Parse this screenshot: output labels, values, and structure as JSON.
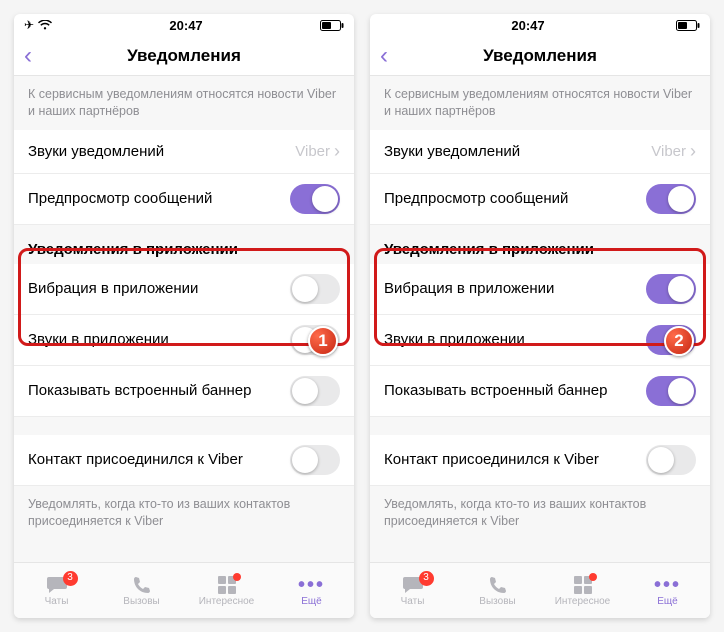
{
  "status": {
    "time": "20:47"
  },
  "nav": {
    "title": "Уведомления"
  },
  "note_service": "К сервисным уведомлениям относятся новости Viber и наших партнёров",
  "rows": {
    "sounds": {
      "label": "Звуки уведомлений",
      "value": "Viber"
    },
    "preview": {
      "label": "Предпросмотр сообщений"
    },
    "section_inapp": "Уведомления в приложении",
    "vibration": {
      "label": "Вибрация в приложении"
    },
    "inapp_sounds": {
      "label": "Звуки в приложении"
    },
    "builtin_banner": {
      "label": "Показывать встроенный баннер"
    },
    "contact_joined": {
      "label": "Контакт присоединился к Viber"
    },
    "note_contact": "Уведомлять, когда кто-то из ваших контактов присоединяется к Viber"
  },
  "screens": {
    "left": {
      "step": "1",
      "vibration_on": false,
      "inapp_sounds_on": false,
      "builtin_on": false,
      "contact_on": false
    },
    "right": {
      "step": "2",
      "vibration_on": true,
      "inapp_sounds_on": true,
      "builtin_on": true,
      "contact_on": false
    }
  },
  "tabs": {
    "chats": {
      "label": "Чаты",
      "badge": "3"
    },
    "calls": {
      "label": "Вызовы"
    },
    "interesting": {
      "label": "Интересное"
    },
    "more": {
      "label": "Ещё"
    }
  }
}
